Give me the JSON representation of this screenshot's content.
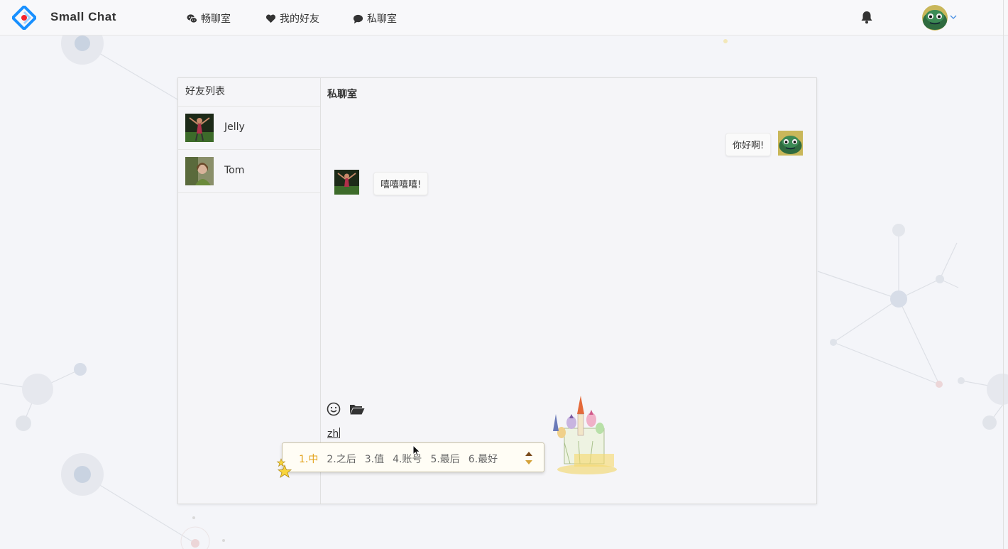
{
  "app": {
    "brand": "Small Chat"
  },
  "nav": {
    "items": [
      {
        "label": "畅聊室",
        "icon": "wechat-icon"
      },
      {
        "label": "我的好友",
        "icon": "heart-icon"
      },
      {
        "label": "私聊室",
        "icon": "chat-bubble-icon"
      }
    ]
  },
  "header": {
    "notification_icon": "bell-icon",
    "user_menu_icon": "chevron-down-icon"
  },
  "friends": {
    "title": "好友列表",
    "items": [
      {
        "name": "Jelly"
      },
      {
        "name": "Tom"
      }
    ]
  },
  "chat": {
    "title": "私聊室",
    "messages": [
      {
        "side": "right",
        "text": "你好啊!"
      },
      {
        "side": "left",
        "text": "嘻嘻嘻嘻!"
      }
    ],
    "toolbar": {
      "emoji_icon": "smiley-icon",
      "file_icon": "folder-open-icon"
    },
    "input_value": "zh"
  },
  "ime": {
    "candidates": [
      "1.中",
      "2.之后",
      "3.值",
      "4.账号",
      "5.最后",
      "6.最好"
    ],
    "selected_index": 0
  },
  "colors": {
    "logo_blue": "#1890ff",
    "logo_red": "#f5222d",
    "ime_active": "#e3a21a",
    "page_bg": "#f4f5f9"
  }
}
